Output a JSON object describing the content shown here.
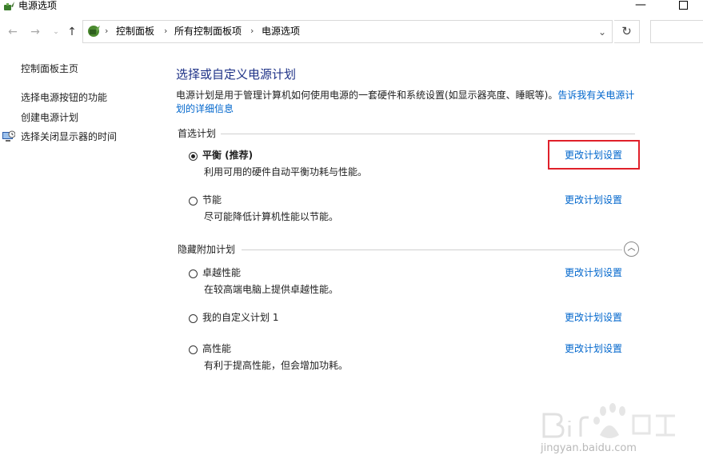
{
  "window": {
    "title": "电源选项",
    "icons": {
      "app": "power-options-icon",
      "minimize": "minimize-icon",
      "maximize": "maximize-icon"
    }
  },
  "nav": {
    "back": "←",
    "forward": "→",
    "recent": "⌄",
    "up": "↑",
    "breadcrumbs": [
      "控制面板",
      "所有控制面板项",
      "电源选项"
    ],
    "separator": "›",
    "dropdown": "⌄",
    "refresh": "↻",
    "search_placeholder": ""
  },
  "sidebar": {
    "items": [
      {
        "label": "控制面板主页"
      },
      {
        "label": "选择电源按钮的功能"
      },
      {
        "label": "创建电源计划"
      },
      {
        "label": "选择关闭显示器的时间",
        "icon": "monitor-clock-icon"
      }
    ]
  },
  "main": {
    "title": "选择或自定义电源计划",
    "intro_text": "电源计划是用于管理计算机如何使用电源的一套硬件和系统设置(如显示器亮度、睡眠等)。",
    "intro_link": "告诉我有关电源计划的详细信息",
    "preferred_group": {
      "label": "首选计划",
      "plans": [
        {
          "name": "平衡 (推荐)",
          "desc": "利用可用的硬件自动平衡功耗与性能。",
          "link": "更改计划设置",
          "selected": true
        },
        {
          "name": "节能",
          "desc": "尽可能降低计算机性能以节能。",
          "link": "更改计划设置",
          "selected": false
        }
      ]
    },
    "hidden_group": {
      "label": "隐藏附加计划",
      "collapse_icon": "chevron-up-icon",
      "plans": [
        {
          "name": "卓越性能",
          "desc": "在较高端电脑上提供卓越性能。",
          "link": "更改计划设置",
          "selected": false
        },
        {
          "name": "我的自定义计划 1",
          "desc": "",
          "link": "更改计划设置",
          "selected": false
        },
        {
          "name": "高性能",
          "desc": "有利于提高性能，但会增加功耗。",
          "link": "更改计划设置",
          "selected": false
        }
      ]
    }
  },
  "watermark": {
    "text": "jingyan.baidu.com",
    "logo": "baidu-jingyan-watermark"
  },
  "colors": {
    "title": "#1e3287",
    "link": "#0066cc",
    "highlight": "#e0202a"
  }
}
